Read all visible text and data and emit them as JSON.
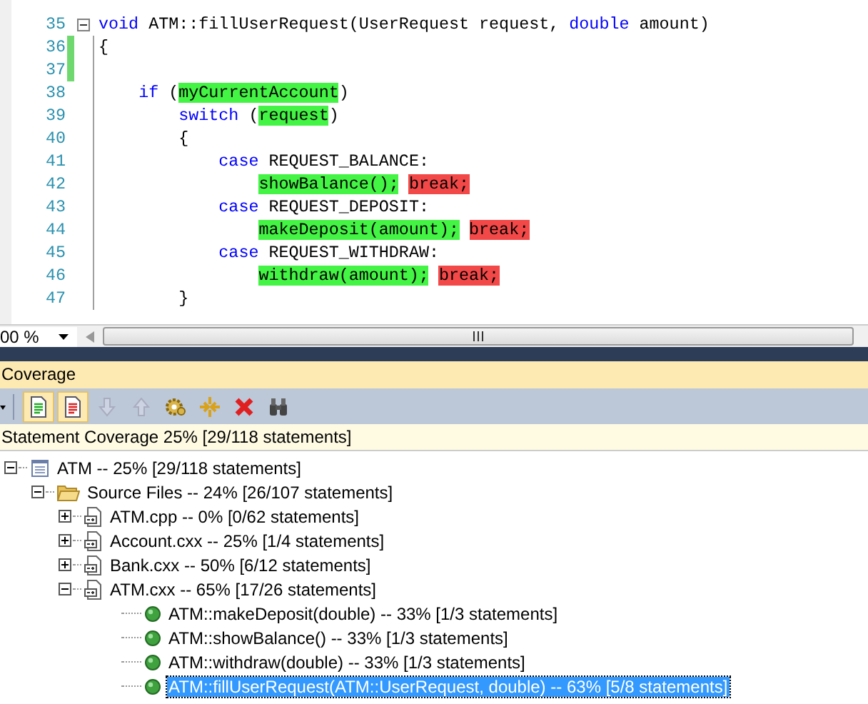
{
  "editor": {
    "lines": [
      {
        "number": "35",
        "fold": true,
        "changed": false,
        "segments": [
          {
            "kind": "keyword",
            "text": "void"
          },
          {
            "kind": "plain",
            "text": " ATM::fillUserRequest(UserRequest request, "
          },
          {
            "kind": "keyword",
            "text": "double"
          },
          {
            "kind": "plain",
            "text": " amount)"
          }
        ]
      },
      {
        "number": "36",
        "fold": false,
        "changed": true,
        "segments": [
          {
            "kind": "plain",
            "text": "{"
          }
        ]
      },
      {
        "number": "37",
        "fold": false,
        "changed": true
      },
      {
        "number": "38",
        "fold": false,
        "changed": false,
        "segments": [
          {
            "kind": "keyword",
            "text": "    if"
          },
          {
            "kind": "plain",
            "text": " ("
          },
          {
            "kind": "covered",
            "text": "myCurrentAccount"
          },
          {
            "kind": "plain",
            "text": ")"
          }
        ]
      },
      {
        "number": "39",
        "fold": false,
        "changed": false,
        "segments": [
          {
            "kind": "keyword",
            "text": "        switch"
          },
          {
            "kind": "plain",
            "text": " ("
          },
          {
            "kind": "covered",
            "text": "request"
          },
          {
            "kind": "plain",
            "text": ")"
          }
        ]
      },
      {
        "number": "40",
        "fold": false,
        "changed": false,
        "segments": [
          {
            "kind": "plain",
            "text": "        {"
          }
        ]
      },
      {
        "number": "41",
        "fold": false,
        "changed": false,
        "segments": [
          {
            "kind": "keyword",
            "text": "            case"
          },
          {
            "kind": "plain",
            "text": " REQUEST_BALANCE:"
          }
        ]
      },
      {
        "number": "42",
        "fold": false,
        "changed": false,
        "segments": [
          {
            "kind": "covered",
            "text": "                showBalance();"
          },
          {
            "kind": "uncovered",
            "text": " break;"
          }
        ]
      },
      {
        "number": "43",
        "fold": false,
        "changed": false,
        "segments": [
          {
            "kind": "keyword",
            "text": "            case"
          },
          {
            "kind": "plain",
            "text": " REQUEST_DEPOSIT:"
          }
        ]
      },
      {
        "number": "44",
        "fold": false,
        "changed": false,
        "segments": [
          {
            "kind": "covered",
            "text": "                makeDeposit(amount);"
          },
          {
            "kind": "uncovered",
            "text": " break;"
          }
        ]
      },
      {
        "number": "45",
        "fold": false,
        "changed": false,
        "segments": [
          {
            "kind": "keyword",
            "text": "            case"
          },
          {
            "kind": "plain",
            "text": " REQUEST_WITHDRAW:"
          }
        ]
      },
      {
        "number": "46",
        "fold": false,
        "changed": false,
        "segments": [
          {
            "kind": "covered",
            "text": "                withdraw(amount);"
          },
          {
            "kind": "uncovered",
            "text": " break;"
          }
        ]
      },
      {
        "number": "47",
        "fold": false,
        "changed": false,
        "segments": [
          {
            "kind": "plain",
            "text": "        }"
          }
        ]
      }
    ],
    "zoom": "00 %"
  },
  "panel": {
    "title": "Coverage",
    "toolbar": [
      {
        "kind": "covered-lines",
        "pressed": true,
        "disabled": false
      },
      {
        "kind": "uncovered-lines",
        "pressed": true,
        "disabled": false
      },
      {
        "kind": "move-down",
        "pressed": false,
        "disabled": true
      },
      {
        "kind": "move-up",
        "pressed": false,
        "disabled": true
      },
      {
        "kind": "settings",
        "pressed": false,
        "disabled": false
      },
      {
        "kind": "collapse-all",
        "pressed": false,
        "disabled": false
      },
      {
        "kind": "delete",
        "pressed": false,
        "disabled": false
      },
      {
        "kind": "find",
        "pressed": false,
        "disabled": false
      }
    ],
    "summary": "Statement Coverage 25% [29/118 statements]",
    "tree": [
      {
        "kind": "project",
        "label": "ATM -- 25% [29/118 statements]",
        "expanded": true,
        "selected": false,
        "children": [
          {
            "kind": "folder",
            "label": "Source Files -- 24% [26/107 statements]",
            "expanded": true,
            "selected": false,
            "children": [
              {
                "kind": "file",
                "label": "ATM.cpp -- 0% [0/62 statements]",
                "expanded": false,
                "selected": false
              },
              {
                "kind": "file",
                "label": "Account.cxx -- 25% [1/4 statements]",
                "expanded": false,
                "selected": false
              },
              {
                "kind": "file",
                "label": "Bank.cxx -- 50% [6/12 statements]",
                "expanded": false,
                "selected": false
              },
              {
                "kind": "file",
                "label": "ATM.cxx -- 65% [17/26 statements]",
                "expanded": true,
                "selected": false,
                "children": [
                  {
                    "kind": "function",
                    "label": "ATM::makeDeposit(double) -- 33% [1/3 statements]",
                    "selected": false
                  },
                  {
                    "kind": "function",
                    "label": "ATM::showBalance() -- 33% [1/3 statements]",
                    "selected": false
                  },
                  {
                    "kind": "function",
                    "label": "ATM::withdraw(double) -- 33% [1/3 statements]",
                    "selected": false
                  },
                  {
                    "kind": "function",
                    "label": "ATM::fillUserRequest(ATM::UserRequest, double) -- 63% [5/8 statements]",
                    "selected": true
                  }
                ]
              }
            ]
          }
        ]
      }
    ]
  }
}
